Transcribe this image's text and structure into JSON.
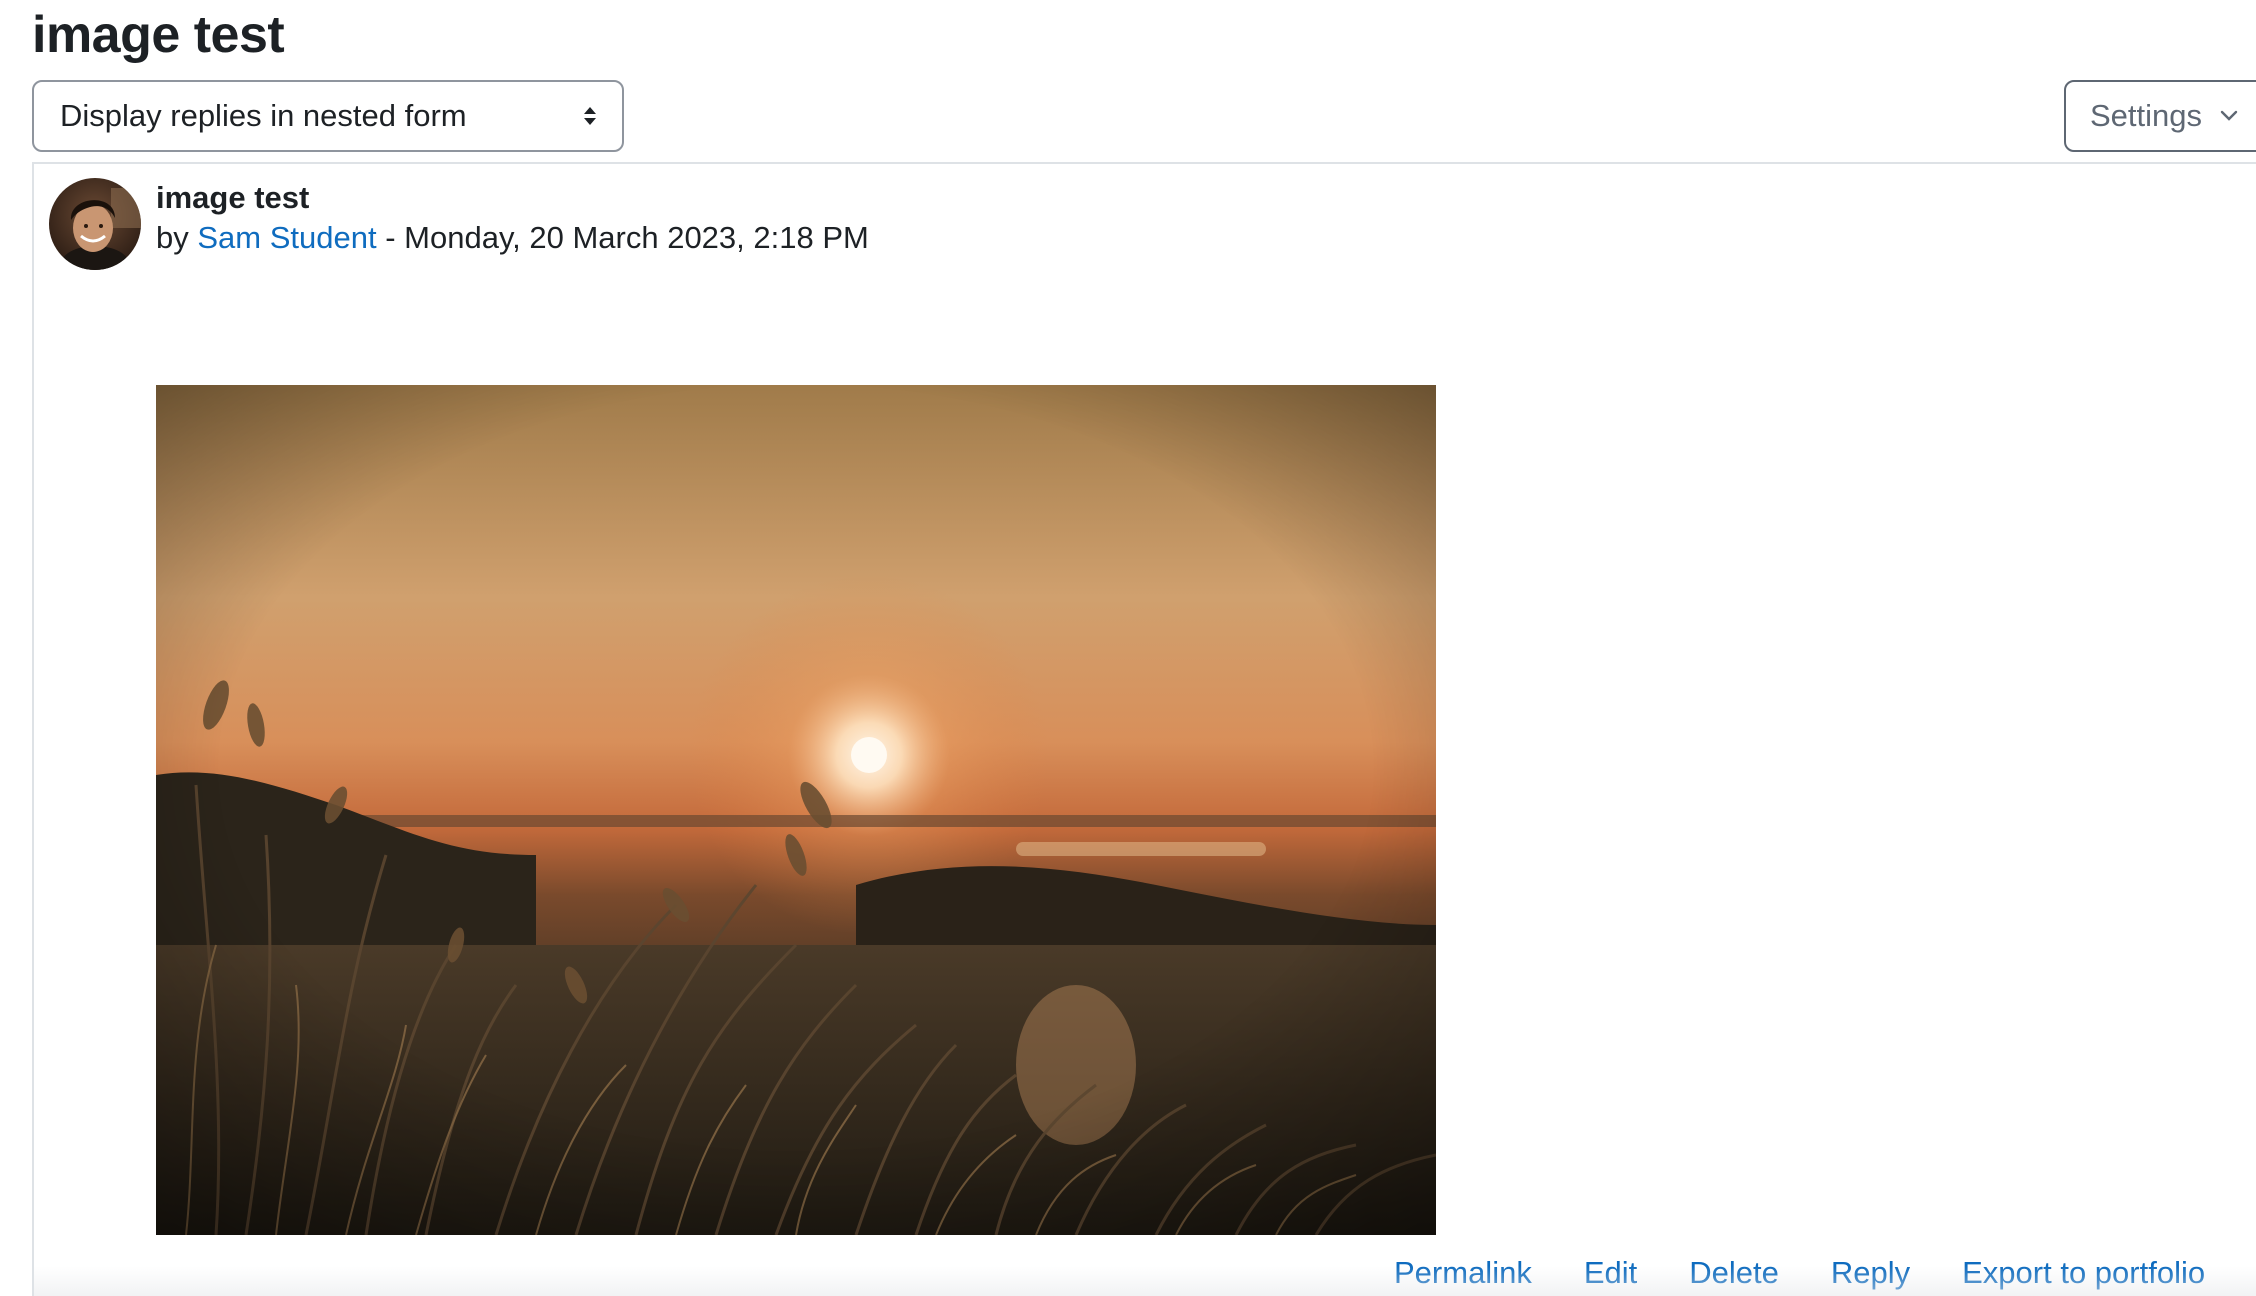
{
  "page": {
    "title": "image test"
  },
  "display_mode": {
    "selected": "Display replies in nested form"
  },
  "settings": {
    "label": "Settings"
  },
  "post": {
    "subject": "image test",
    "by_prefix": "by",
    "author": "Sam Student",
    "separator": " - ",
    "date": "Monday, 20 March 2023, 2:18 PM",
    "image_alt": "Sunset over grassy dunes"
  },
  "actions": {
    "permalink": "Permalink",
    "edit": "Edit",
    "delete": "Delete",
    "reply": "Reply",
    "export": "Export to portfolio"
  },
  "colors": {
    "link": "#0f6cbf",
    "text": "#1d2125",
    "border": "#8f959e"
  }
}
